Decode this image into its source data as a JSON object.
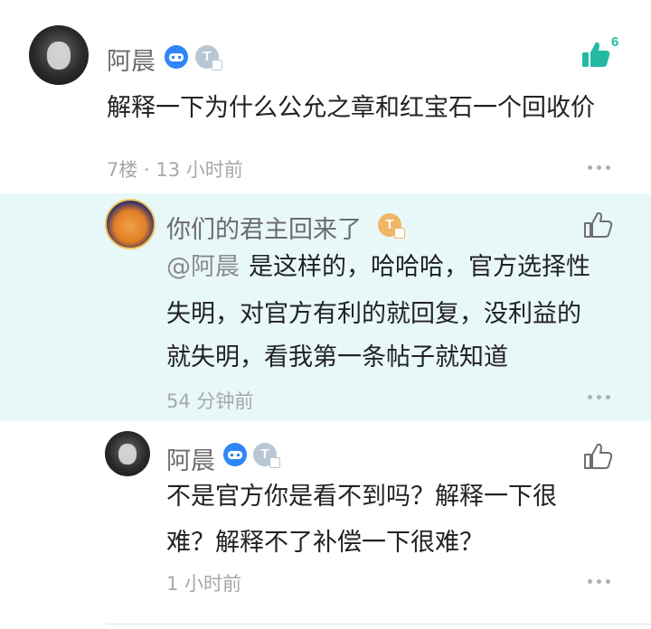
{
  "post": {
    "author": "阿晨",
    "content": "解释一下为什么公允之章和红宝石一个回收价",
    "meta": "7楼 · 13 小时前",
    "like_count": "6"
  },
  "replies": [
    {
      "author": "你们的君主回来了",
      "mention": "@阿晨",
      "lines": [
        "是这样的，哈哈哈，官方选择性",
        "失明，对官方有利的就回复，没利益的",
        "就失明，看我第一条帖子就知道"
      ],
      "time": "54 分钟前",
      "highlighted": true
    },
    {
      "author": "阿晨",
      "lines": [
        "不是官方你是看不到吗？解释一下很",
        "难？解释不了补偿一下很难？"
      ],
      "time": "1 小时前",
      "highlighted": false
    }
  ],
  "badges": {
    "t_letter": "T"
  },
  "icons": [
    "game-controller-badge-icon",
    "level-t-badge-icon",
    "thumbs-up-icon",
    "more-dots-icon"
  ],
  "colors": {
    "accent": "#23b9a3",
    "highlight_bg": "#e8f8f8",
    "game_badge": "#2f86f6"
  }
}
